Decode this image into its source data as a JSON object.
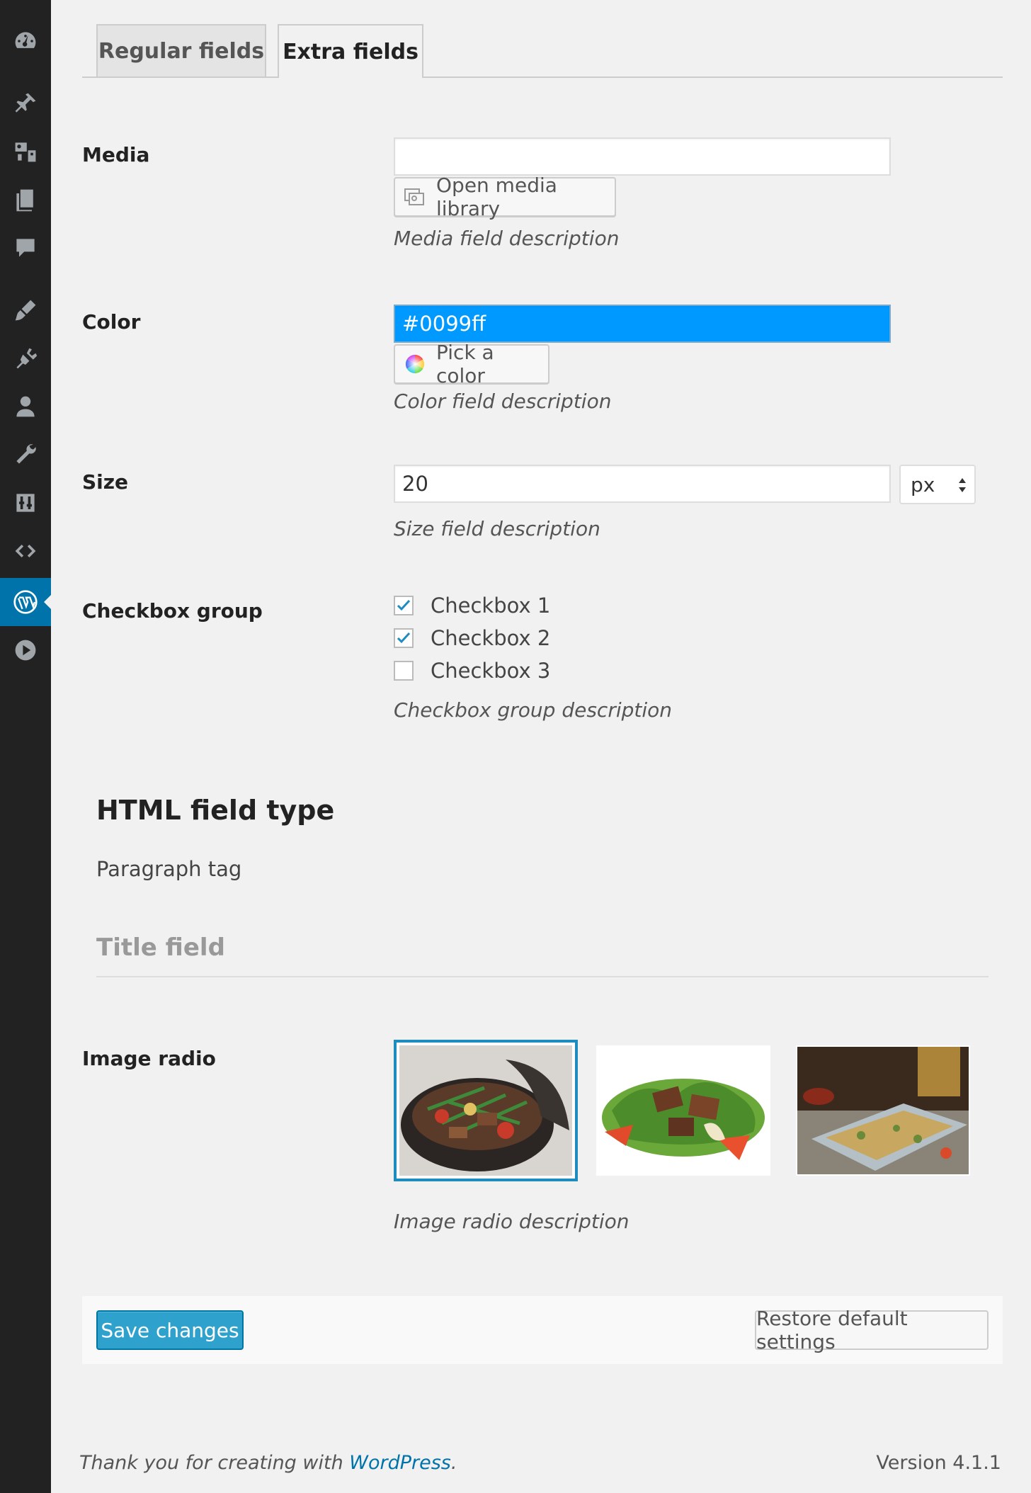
{
  "tabs": [
    {
      "label": "Regular fields",
      "active": false
    },
    {
      "label": "Extra fields",
      "active": true
    }
  ],
  "media": {
    "label": "Media",
    "value": "",
    "button_label": "Open media library",
    "description": "Media field description"
  },
  "color": {
    "label": "Color",
    "value": "#0099ff",
    "button_label": "Pick a color",
    "description": "Color field description"
  },
  "size": {
    "label": "Size",
    "value": "20",
    "unit": "px",
    "description": "Size field description"
  },
  "checkbox_group": {
    "label": "Checkbox group",
    "items": [
      {
        "label": "Checkbox 1",
        "checked": true
      },
      {
        "label": "Checkbox 2",
        "checked": true
      },
      {
        "label": "Checkbox 3",
        "checked": false
      }
    ],
    "description": "Checkbox group description"
  },
  "html_field": {
    "heading": "HTML field type",
    "paragraph": "Paragraph tag"
  },
  "title_field": {
    "text": "Title field"
  },
  "image_radio": {
    "label": "Image radio",
    "options": [
      {
        "name": "stew-pot",
        "selected": true
      },
      {
        "name": "beef-salad",
        "selected": false
      },
      {
        "name": "flatbread",
        "selected": false
      }
    ],
    "description": "Image radio description"
  },
  "actions": {
    "save_label": "Save changes",
    "restore_label": "Restore default settings"
  },
  "footer": {
    "thanks_prefix": "Thank you for creating with ",
    "thanks_link": "WordPress",
    "thanks_suffix": ".",
    "version": "Version 4.1.1"
  },
  "sidebar": {
    "icons": [
      "dashboard-icon",
      "posts-pin-icon",
      "media-icon",
      "pages-icon",
      "comments-icon",
      "appearance-brush-icon",
      "plugins-icon",
      "users-icon",
      "tools-wrench-icon",
      "settings-icon",
      "code-icon",
      "wordpress-icon",
      "play-icon"
    ],
    "active_index": 11
  },
  "colors": {
    "accent": "#0073aa",
    "color_value_bg": "#0099ff",
    "primary_button": "#2ea2cc",
    "sidebar_bg": "#222222",
    "link": "#0073aa"
  }
}
